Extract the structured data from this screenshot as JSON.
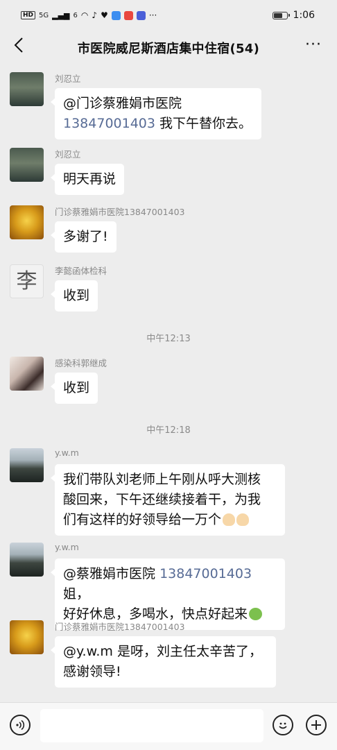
{
  "status_bar": {
    "hd": "HD",
    "signal": "5G",
    "signal2": "6",
    "time": "1:06"
  },
  "header": {
    "title": "市医院威尼斯酒店集中住宿(54)",
    "back_icon": "chevron-left-icon",
    "more_icon": "more-dots-icon",
    "more_text": "···"
  },
  "messages": [
    {
      "sender": "刘忍立",
      "avatar": "pond",
      "parts": [
        "@门诊蔡雅娟市医院",
        "13847001403",
        "我下午替你去。"
      ]
    },
    {
      "sender": "刘忍立",
      "avatar": "pond",
      "text": "明天再说"
    },
    {
      "sender": "门诊蔡雅娟市医院13847001403",
      "avatar": "buddha",
      "text": "多谢了!"
    },
    {
      "sender": "李懿函体检科",
      "avatar": "li",
      "avatar_char": "李",
      "text": "收到"
    },
    {
      "sender": "感染科郭继成",
      "avatar": "girl",
      "text": "收到"
    },
    {
      "sender": "y.w.m",
      "avatar": "lake",
      "lines": [
        "我们带队刘老师上午刚从呼大测核",
        "酸回来，下午还继续接着干，为我",
        "们有这样的好领导给一万个"
      ]
    },
    {
      "sender": "y.w.m",
      "avatar": "lake",
      "parts": [
        "@蔡雅娟市医院",
        "13847001403",
        "姐，",
        "好好休息，多喝水，快点好起来"
      ]
    },
    {
      "sender": "门诊蔡雅娟市医院13847001403",
      "avatar": "buddha",
      "lines": [
        "@y.w.m 是呀，刘主任太辛苦了，",
        "感谢领导!"
      ]
    }
  ],
  "timestamps": [
    "中午12:13",
    "中午12:18"
  ],
  "input_bar": {
    "voice_icon": "voice-icon",
    "emoji_icon": "emoji-icon",
    "plus_icon": "plus-icon",
    "text": ""
  }
}
